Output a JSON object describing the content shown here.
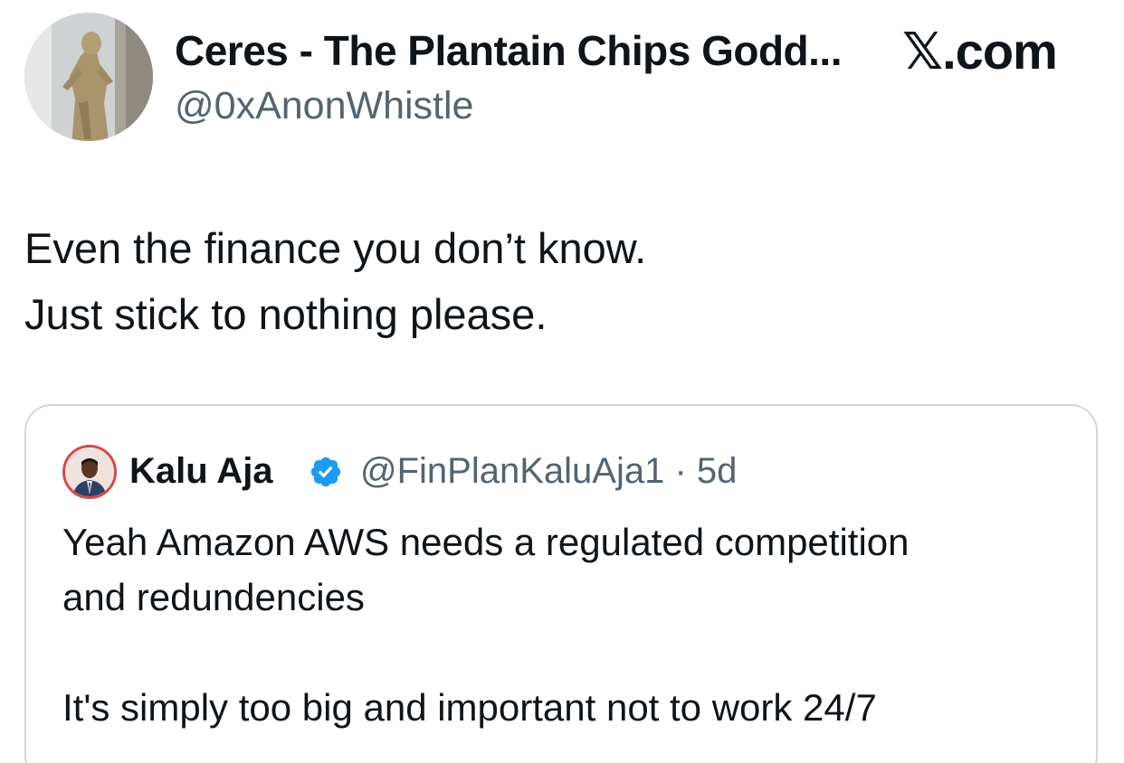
{
  "author": {
    "display_name": "Ceres - The Plantain Chips Godd...",
    "handle": "@0xAnonWhistle",
    "avatar_icon": "statue-avatar-photo"
  },
  "brand": {
    "label": "𝕏.com"
  },
  "tweet": {
    "lines": [
      "Even the finance you don’t know.",
      "Just stick to nothing please."
    ]
  },
  "quoted_tweet": {
    "display_name": "Kalu Aja",
    "verified_icon": "verified-badge-icon",
    "handle_and_time": "@FinPlanKaluAja1 · 5d",
    "avatar_icon": "profile-photo-avatar",
    "lines": [
      "Yeah Amazon AWS needs a regulated competition",
      "and redundencies",
      "",
      "It's simply too big and important not to work 24/7"
    ]
  },
  "colors": {
    "text_primary": "#0f1419",
    "text_secondary": "#536471",
    "border": "#cfd9de",
    "verified_blue": "#1d9bf0"
  }
}
